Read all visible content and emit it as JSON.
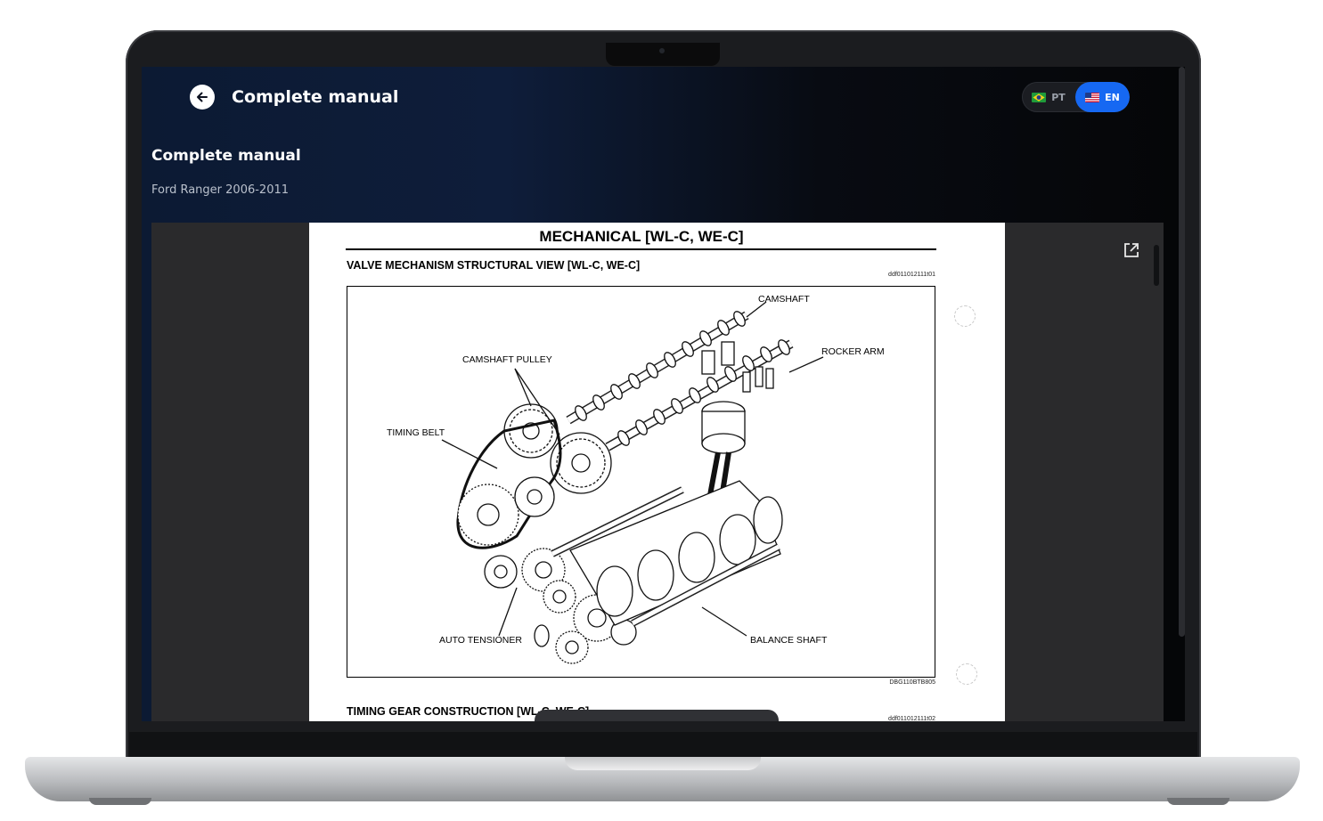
{
  "header": {
    "title": "Complete manual",
    "back_icon": "arrow-left-icon"
  },
  "language": {
    "options": [
      {
        "code": "PT",
        "flag": "brazil-flag-icon",
        "selected": false
      },
      {
        "code": "EN",
        "flag": "usa-flag-icon",
        "selected": true
      }
    ],
    "active_color": "#1668f2"
  },
  "page": {
    "title": "Complete manual",
    "subtitle": "Ford Ranger 2006-2011"
  },
  "document": {
    "header": "MECHANICAL [WL-C, WE-C]",
    "section_title": "VALVE MECHANISM STRUCTURAL VIEW [WL-C, WE-C]",
    "section_code": "ddf011012111t01",
    "figure_labels": {
      "camshaft": "CAMSHAFT",
      "rocker_arm": "ROCKER ARM",
      "camshaft_pulley": "CAMSHAFT PULLEY",
      "timing_belt": "TIMING BELT",
      "auto_tensioner": "AUTO TENSIONER",
      "balance_shaft": "BALANCE SHAFT"
    },
    "figure_code": "DBG110BTB805",
    "next_section_title": "TIMING GEAR CONSTRUCTION [WL-C, WE-C]",
    "next_section_code": "ddf011012111t02"
  },
  "viewer": {
    "open_external_icon": "open-external-icon"
  }
}
